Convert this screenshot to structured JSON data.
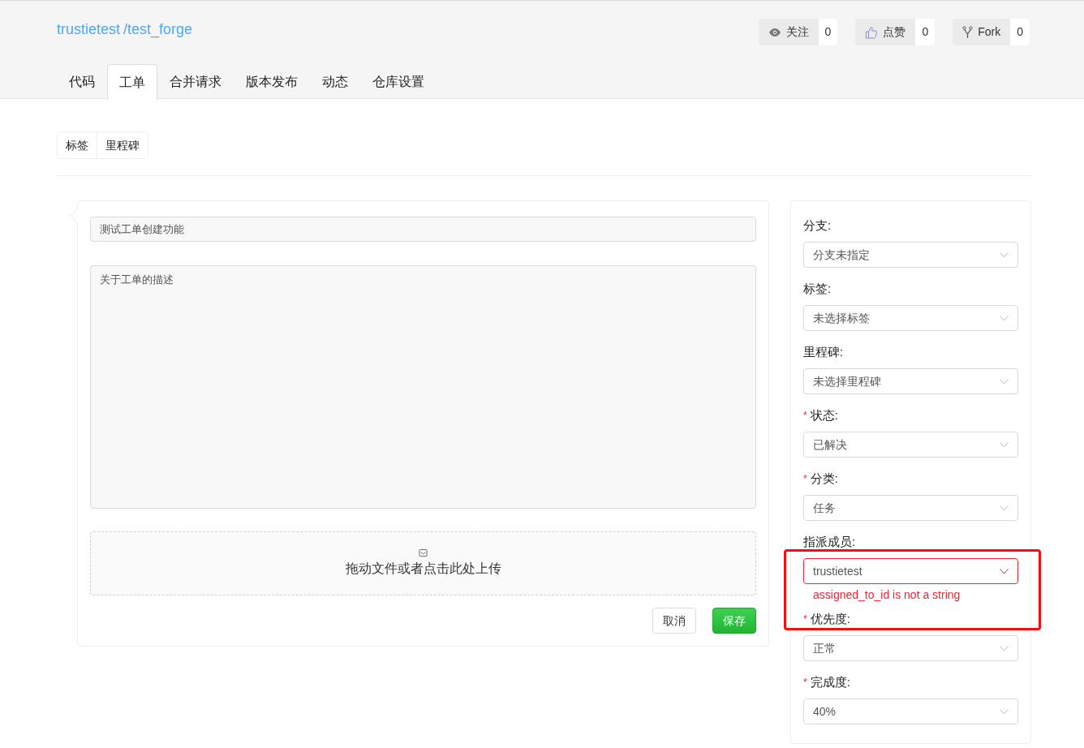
{
  "repo": {
    "owner": "trustietest",
    "name": "/test_forge"
  },
  "stats": [
    {
      "kind": "watch",
      "label": "关注",
      "count": "0"
    },
    {
      "kind": "like",
      "label": "点赞",
      "count": "0"
    },
    {
      "kind": "fork",
      "label": "Fork",
      "count": "0"
    }
  ],
  "tabs": [
    {
      "label": "代码",
      "selected": false
    },
    {
      "label": "工单",
      "selected": true
    },
    {
      "label": "合并请求",
      "selected": false
    },
    {
      "label": "版本发布",
      "selected": false
    },
    {
      "label": "动态",
      "selected": false
    },
    {
      "label": "仓库设置",
      "selected": false
    }
  ],
  "sub_buttons": [
    "标签",
    "里程碑"
  ],
  "issue_form": {
    "title_value": "测试工单创建功能",
    "description_placeholder": "关于工单的描述",
    "upload_text": "拖动文件或者点击此处上传",
    "cancel": "取消",
    "save": "保存"
  },
  "fields": [
    {
      "label": "分支:",
      "value": "分支未指定"
    },
    {
      "label": "标签:",
      "value": "未选择标签"
    },
    {
      "label": "里程碑:",
      "value": "未选择里程碑"
    },
    {
      "required_mark": "*",
      "label": "状态:",
      "value": "已解决"
    },
    {
      "required_mark": "*",
      "label": "分类:",
      "value": "任务"
    },
    {
      "label": "指派成员:",
      "value": "trustietest",
      "error": "assigned_to_id is not a string"
    },
    {
      "required_mark": "*",
      "label": "优先度:",
      "value": "正常"
    },
    {
      "required_mark": "*",
      "label": "完成度:",
      "value": "40%"
    }
  ]
}
